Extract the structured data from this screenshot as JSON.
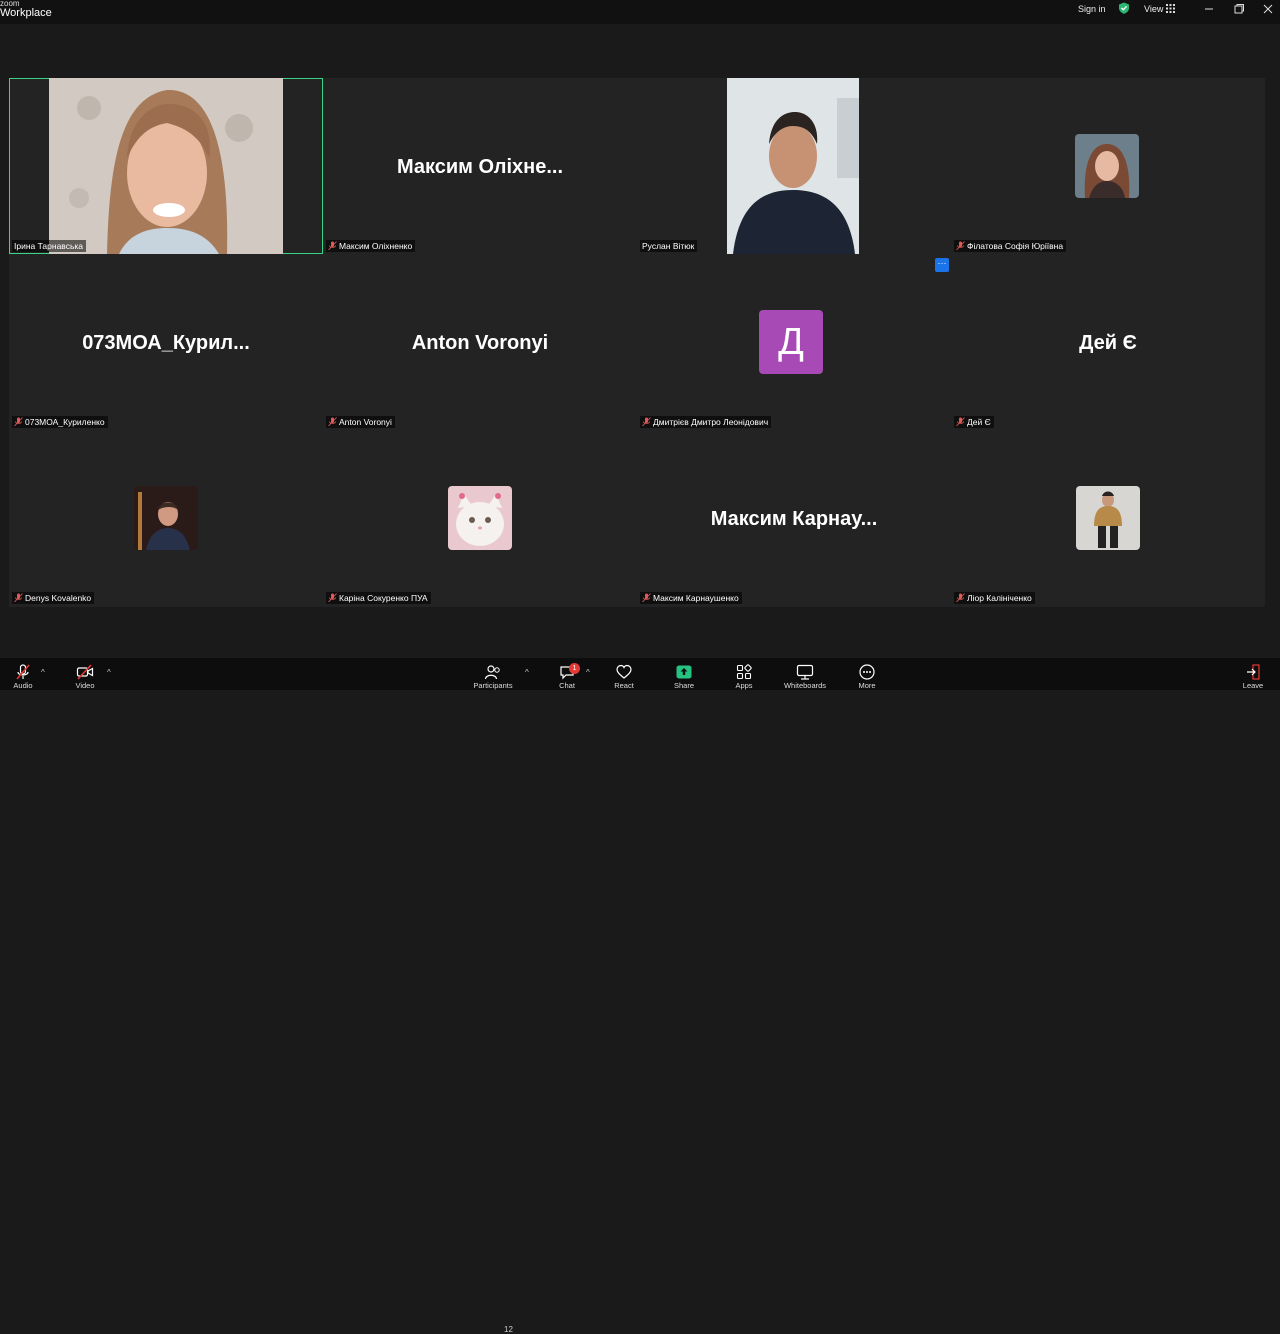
{
  "titlebar": {
    "brand_small": "zoom",
    "brand_main": "Workplace",
    "sign_in": "Sign in",
    "view": "View"
  },
  "tiles": [
    {
      "display": "",
      "label": "Ірина Тарнавська",
      "muted": false,
      "active": true
    },
    {
      "display": "Максим  Оліхне...",
      "label": "Максим Оліхненко",
      "muted": true
    },
    {
      "display": "",
      "label": "Руслан Вітюк",
      "muted": false
    },
    {
      "display": "",
      "label": "Філатова Софія Юріївна",
      "muted": true
    },
    {
      "display": "073МОА_Курил...",
      "label": "073МОА_Куриленко",
      "muted": true
    },
    {
      "display": "Anton Voronyi",
      "label": "Anton Voronyi",
      "muted": true
    },
    {
      "display": "Д",
      "label": "Дмитрієв Дмитро Леонідович",
      "muted": true
    },
    {
      "display": "Дей Є",
      "label": "Дей Є",
      "muted": true
    },
    {
      "display": "",
      "label": "Denys Kovalenko",
      "muted": true
    },
    {
      "display": "",
      "label": "Каріна Сокуренко ПУА",
      "muted": true
    },
    {
      "display": "Максим  Карнау...",
      "label": "Максим Карнаушенко",
      "muted": true
    },
    {
      "display": "",
      "label": "Ліор Калініченко",
      "muted": true
    }
  ],
  "more_badge": "···",
  "toolbar": {
    "audio": "Audio",
    "video": "Video",
    "participants": "Participants",
    "participants_count": "12",
    "chat": "Chat",
    "chat_badge": "1",
    "react": "React",
    "share": "Share",
    "apps": "Apps",
    "whiteboards": "Whiteboards",
    "more": "More",
    "leave": "Leave"
  },
  "colors": {
    "active_border": "#3ad38a",
    "avatar_letter_bg": "#a84ab5",
    "share_green": "#26c281",
    "badge_red": "#e53935",
    "more_badge_blue": "#1a73e8"
  },
  "icons": [
    "zoom-logo",
    "shield-check-icon",
    "grid-icon",
    "minimize-icon",
    "restore-icon",
    "close-icon",
    "mic-muted-icon",
    "video-off-icon",
    "participants-icon",
    "chat-icon",
    "heart-icon",
    "share-icon",
    "apps-icon",
    "whiteboard-icon",
    "more-icon",
    "leave-icon"
  ]
}
